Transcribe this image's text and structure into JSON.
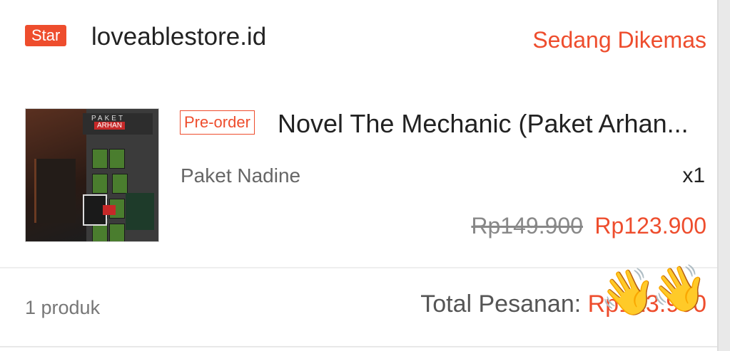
{
  "shop": {
    "badge": "Star",
    "name": "loveablestore.id",
    "status": "Sedang Dikemas"
  },
  "item": {
    "image_title_line1": "PAKET",
    "image_title_line2": "ARHAN",
    "tag": "Pre-order",
    "name": "Novel The Mechanic (Paket Arhan...",
    "variant": "Paket Nadine",
    "quantity": "x1",
    "original_price": "Rp149.900",
    "price": "Rp123.900"
  },
  "summary": {
    "count": "1 produk",
    "total_label": "Total Pesanan: ",
    "total_value": "Rp123.900"
  },
  "overlay": {
    "emoji": "👋"
  },
  "colors": {
    "accent": "#ee4d2d",
    "text": "#222222",
    "muted": "#777777"
  }
}
